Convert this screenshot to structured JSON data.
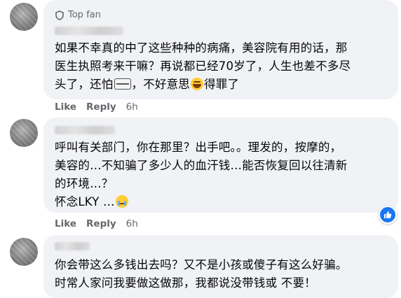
{
  "comments": [
    {
      "badge": "Top fan",
      "lines": [
        "如果不幸真的中了这些种种的病痛，美容院有用的话，那",
        "医生执照考来干嘛？再说都已经70岁了，人生也差不多尽",
        "头了，还怕",
        "，不好意思",
        "得罪了"
      ],
      "like": "Like",
      "reply": "Reply",
      "time": "6h"
    },
    {
      "lines": [
        "呼叫有关部门，你在那里？出手吧。。理发的，按摩的，",
        "美容的…不知骗了多少人的血汗钱…能否恢复回以往清新",
        "的环境…？",
        "怀念LKY …"
      ],
      "like": "Like",
      "reply": "Reply",
      "time": "6h"
    },
    {
      "lines": [
        "你会带这么多钱出去吗？又不是小孩或傻子有这么好骗。",
        "时常人家问我要做这做那，我都说没带钱或 不要！"
      ]
    }
  ],
  "icons": {
    "badge": "top-fan-badge-icon",
    "reaction": "like-reaction-icon",
    "emoji_grimace": "grimace-emoji-icon",
    "emoji_laugh": "laughing-emoji-icon",
    "emoji_cry": "crying-emoji-icon"
  },
  "colors": {
    "bubble": "#f0f2f5",
    "meta": "#65676b",
    "like_blue": "#1877f2"
  }
}
